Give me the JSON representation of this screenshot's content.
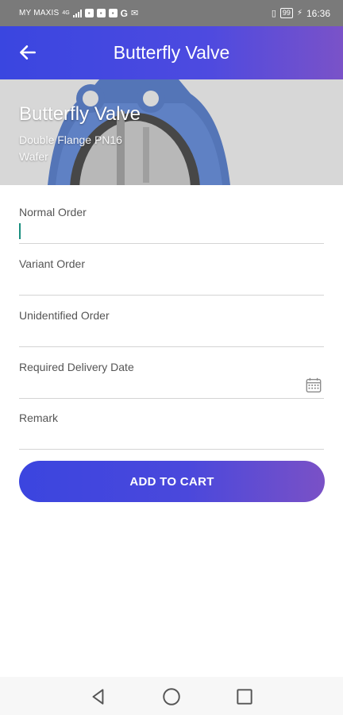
{
  "status_bar": {
    "carrier": "MY MAXIS",
    "signal_type": "4G",
    "google_letter": "G",
    "battery": "99",
    "time": "16:36",
    "icons": [
      "signal-icon",
      "app-notification-icon",
      "app-notification-icon",
      "app-notification-icon",
      "google-icon",
      "mail-icon",
      "vibrate-icon",
      "battery-icon",
      "charging-icon"
    ]
  },
  "app_bar": {
    "title": "Butterfly Valve",
    "back_icon": "arrow-left-icon"
  },
  "hero": {
    "title": "Butterfly Valve",
    "subtitle_line1": "Double Flange PN16",
    "subtitle_line2": "Wafer"
  },
  "form": {
    "fields": [
      {
        "label": "Normal Order",
        "value": ""
      },
      {
        "label": "Variant Order",
        "value": ""
      },
      {
        "label": "Unidentified Order",
        "value": ""
      },
      {
        "label": "Required Delivery Date",
        "value": "",
        "icon": "calendar-icon"
      },
      {
        "label": "Remark",
        "value": ""
      }
    ],
    "submit_label": "ADD TO CART"
  },
  "colors": {
    "primary_start": "#3a46e0",
    "primary_end": "#7a52c8",
    "cursor": "#1a8f7f"
  },
  "nav_bar": {
    "icons": [
      "back-triangle-icon",
      "home-circle-icon",
      "recents-square-icon"
    ]
  }
}
